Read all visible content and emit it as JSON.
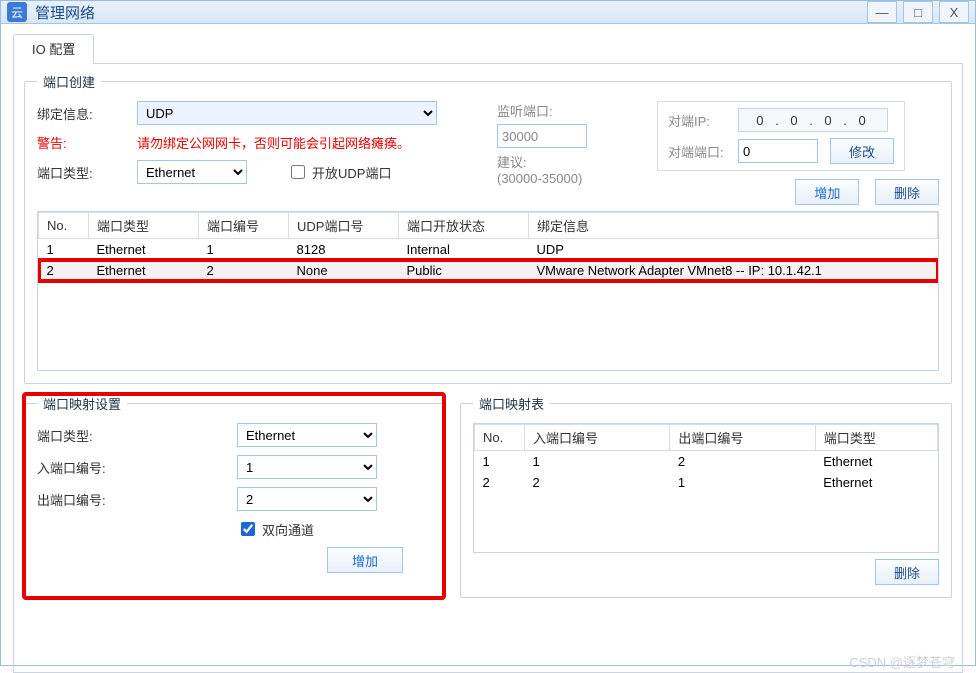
{
  "window": {
    "title": "管理网络"
  },
  "tabs": {
    "io": "IO 配置"
  },
  "port_create": {
    "legend": "端口创建",
    "bind_label": "绑定信息:",
    "bind_value": "UDP",
    "warn_label": "警告:",
    "warn_text": "请勿绑定公网网卡，否则可能会引起网络瘫痪。",
    "type_label": "端口类型:",
    "type_value": "Ethernet",
    "open_udp_label": "开放UDP端口",
    "listen_label": "监听端口:",
    "listen_value": "30000",
    "suggest_label": "建议:",
    "suggest_range": "(30000-35000)",
    "peer_ip_label": "对端IP:",
    "peer_ip_value": "0 . 0 . 0 . 0",
    "peer_port_label": "对端端口:",
    "peer_port_value": "0",
    "modify_btn": "修改",
    "add_btn": "增加",
    "del_btn": "删除",
    "cols": {
      "no": "No.",
      "type": "端口类型",
      "num": "端口编号",
      "udp": "UDP端口号",
      "open": "端口开放状态",
      "bind": "绑定信息"
    },
    "rows": [
      {
        "no": "1",
        "type": "Ethernet",
        "num": "1",
        "udp": "8128",
        "open": "Internal",
        "bind": "UDP"
      },
      {
        "no": "2",
        "type": "Ethernet",
        "num": "2",
        "udp": "None",
        "open": "Public",
        "bind": "VMware Network Adapter VMnet8 -- IP: 10.1.42.1"
      }
    ]
  },
  "port_map_set": {
    "legend": "端口映射设置",
    "type_label": "端口类型:",
    "type_value": "Ethernet",
    "in_label": "入端口编号:",
    "in_value": "1",
    "out_label": "出端口编号:",
    "out_value": "2",
    "bi_label": "双向通道",
    "add_btn": "增加"
  },
  "port_map_tbl": {
    "legend": "端口映射表",
    "cols": {
      "no": "No.",
      "in": "入端口编号",
      "out": "出端口编号",
      "type": "端口类型"
    },
    "rows": [
      {
        "no": "1",
        "in": "1",
        "out": "2",
        "type": "Ethernet"
      },
      {
        "no": "2",
        "in": "2",
        "out": "1",
        "type": "Ethernet"
      }
    ],
    "del_btn": "删除"
  },
  "watermark": "CSDN @逐梦苍穹"
}
